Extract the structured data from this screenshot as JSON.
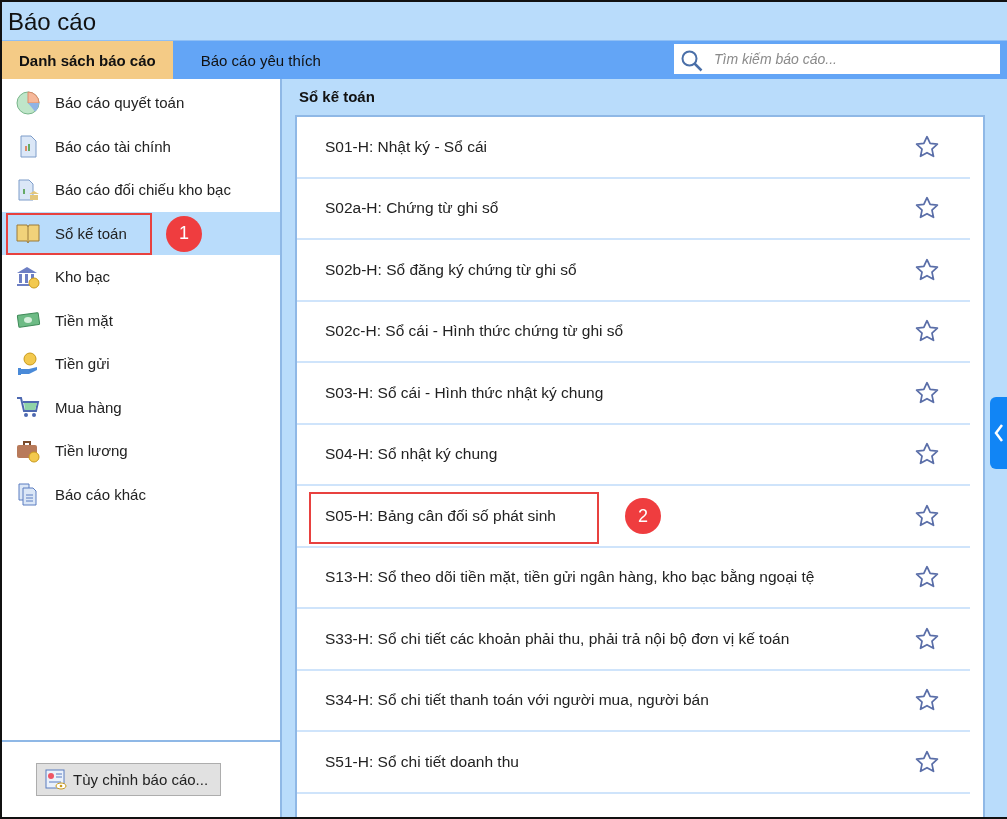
{
  "window": {
    "title": "Báo cáo"
  },
  "tabs": [
    {
      "label": "Danh sách báo cáo",
      "selected": true
    },
    {
      "label": "Báo cáo yêu thích",
      "selected": false
    }
  ],
  "search": {
    "placeholder": "Tìm kiếm báo cáo..."
  },
  "sidebar": {
    "items": [
      {
        "label": "Báo cáo quyết toán",
        "selected": false
      },
      {
        "label": "Báo cáo tài chính",
        "selected": false
      },
      {
        "label": "Báo cáo đối chiếu kho bạc",
        "selected": false
      },
      {
        "label": "Sổ kế toán",
        "selected": true,
        "callout": "1"
      },
      {
        "label": "Kho bạc",
        "selected": false
      },
      {
        "label": "Tiền mặt",
        "selected": false
      },
      {
        "label": "Tiền gửi",
        "selected": false
      },
      {
        "label": "Mua hàng",
        "selected": false
      },
      {
        "label": "Tiền lương",
        "selected": false
      },
      {
        "label": "Báo cáo khác",
        "selected": false
      }
    ],
    "button": "Tùy chỉnh báo cáo..."
  },
  "panel": {
    "title": "Sổ kế toán",
    "reports": [
      {
        "label": "S01-H: Nhật ký - Sổ cái",
        "favorite": false
      },
      {
        "label": "S02a-H: Chứng từ ghi sổ",
        "favorite": false
      },
      {
        "label": "S02b-H: Sổ đăng ký chứng từ ghi sổ",
        "favorite": false
      },
      {
        "label": "S02c-H: Sổ cái - Hình thức chứng từ ghi sổ",
        "favorite": false
      },
      {
        "label": "S03-H: Sổ cái - Hình thức nhật ký chung",
        "favorite": false
      },
      {
        "label": "S04-H: Sổ nhật ký chung",
        "favorite": false
      },
      {
        "label": "S05-H: Bảng cân đối số phát sinh",
        "favorite": false,
        "callout": "2"
      },
      {
        "label": "S13-H: Sổ theo dõi tiền mặt, tiền gửi ngân hàng, kho bạc bằng ngoại tệ",
        "favorite": false
      },
      {
        "label": "S33-H: Sổ chi tiết các khoản phải thu, phải trả nội bộ đơn vị kế toán",
        "favorite": false
      },
      {
        "label": "S34-H: Sổ chi tiết thanh toán với người mua, người bán",
        "favorite": false
      },
      {
        "label": "S51-H: Sổ chi tiết doanh thu",
        "favorite": false
      }
    ]
  }
}
